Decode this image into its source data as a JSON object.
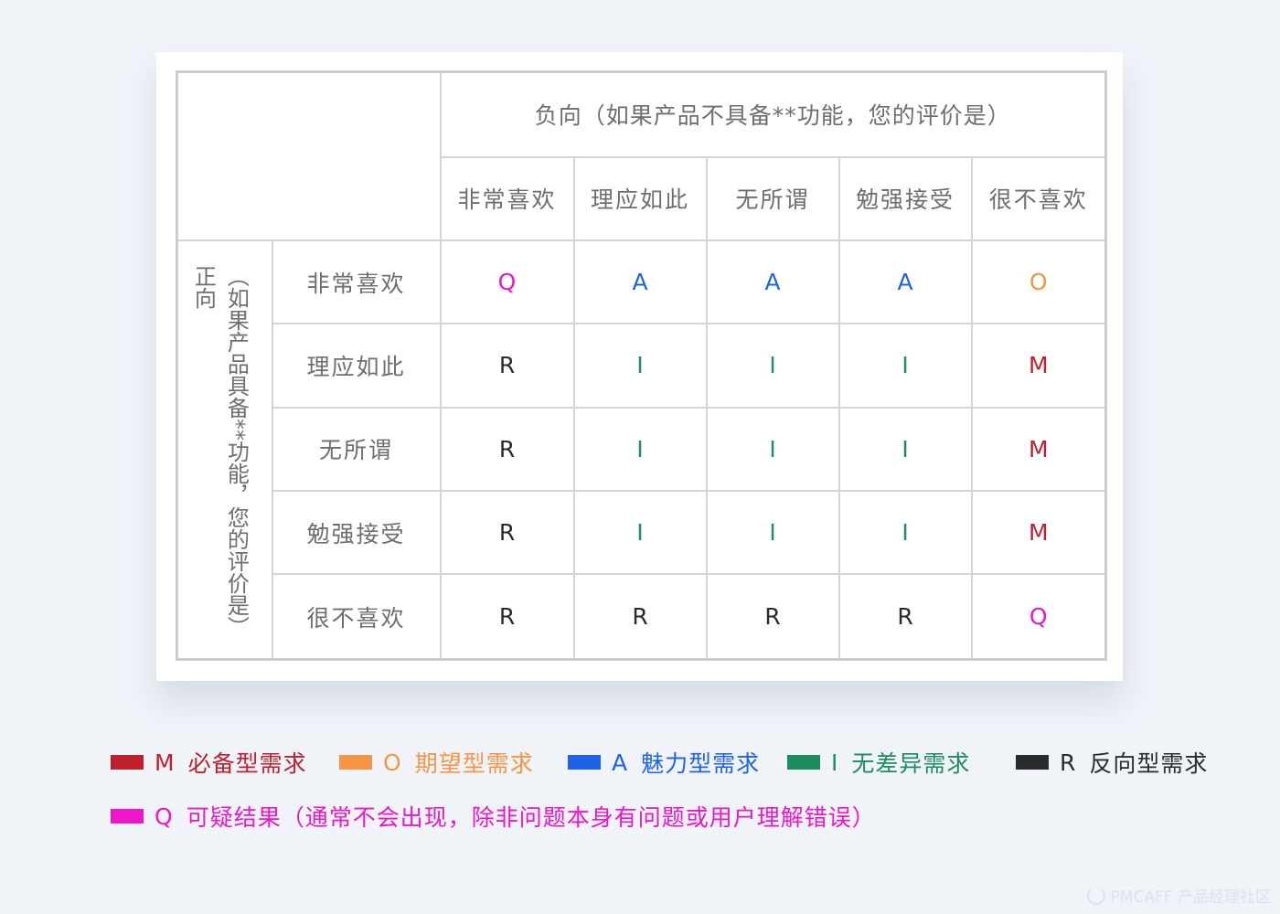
{
  "table": {
    "negative_header": "负向（如果产品不具备**功能，您的评价是）",
    "positive_title": "正向",
    "positive_subtitle": "（如果产品具备**功能，您的评价是）",
    "columns": [
      "非常喜欢",
      "理应如此",
      "无所谓",
      "勉强接受",
      "很不喜欢"
    ],
    "rows": [
      {
        "label": "非常喜欢",
        "cells": [
          "Q",
          "A",
          "A",
          "A",
          "O"
        ]
      },
      {
        "label": "理应如此",
        "cells": [
          "R",
          "I",
          "I",
          "I",
          "M"
        ]
      },
      {
        "label": "无所谓",
        "cells": [
          "R",
          "I",
          "I",
          "I",
          "M"
        ]
      },
      {
        "label": "勉强接受",
        "cells": [
          "R",
          "I",
          "I",
          "I",
          "M"
        ]
      },
      {
        "label": "很不喜欢",
        "cells": [
          "R",
          "R",
          "R",
          "R",
          "Q"
        ]
      }
    ]
  },
  "colors": {
    "M": "#c0202e",
    "O": "#f59545",
    "A": "#1e63e6",
    "I": "#1e8c5c",
    "R": "#2b2b2b",
    "Q": "#ee16c8"
  },
  "legend": [
    {
      "code": "M",
      "label": "必备型需求"
    },
    {
      "code": "O",
      "label": "期望型需求"
    },
    {
      "code": "A",
      "label": "魅力型需求"
    },
    {
      "code": "I",
      "label": "无差异需求"
    },
    {
      "code": "R",
      "label": "反向型需求"
    },
    {
      "code": "Q",
      "label": "可疑结果（通常不会出现，除非问题本身有问题或用户理解错误）"
    }
  ],
  "watermark": "PMCAFF 产品经理社区"
}
